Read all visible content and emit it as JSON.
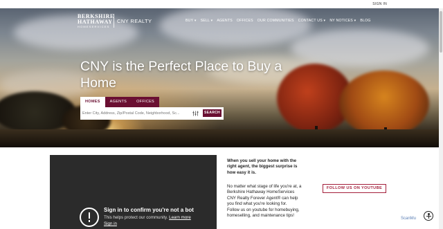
{
  "topbar": {
    "signin": "SIGN IN"
  },
  "brand": {
    "line1": "BERKSHIRE",
    "line2": "HATHAWAY",
    "line3": "HOMESERVICES",
    "office": "CNY REALTY"
  },
  "nav": {
    "items": [
      {
        "label": "BUY ▾"
      },
      {
        "label": "SELL ▾"
      },
      {
        "label": "AGENTS"
      },
      {
        "label": "OFFICES"
      },
      {
        "label": "OUR COMMUNITIES"
      },
      {
        "label": "CONTACT US ▾"
      },
      {
        "label": "NY NOTICES ▾"
      },
      {
        "label": "BLOG"
      }
    ]
  },
  "hero": {
    "headline": "CNY is the Perfect Place to Buy a Home"
  },
  "search": {
    "tabs": [
      {
        "label": "HOMES"
      },
      {
        "label": "AGENTS"
      },
      {
        "label": "OFFICES"
      }
    ],
    "placeholder": "Enter City, Address, Zip/Postal Code, Neighborhood, Sc...",
    "button": "SEARCH"
  },
  "video": {
    "title": "Sign in to confirm you're not a bot",
    "subtitle": "This helps protect our community.",
    "learn_more": "Learn more",
    "signin": "Sign in"
  },
  "content": {
    "lead": "When you sell your home with the right agent, the biggest surprise is how easy it is.",
    "body1": "No matter what stage of life you're at, a Berkshire Hathaway HomeServices CNY Realty Forever Agent® can help you find what you're looking for.",
    "body2": "Follow us on youtube for homebuying, homeselling, and maintenance tips!",
    "youtube_button": "FOLLOW US ON YOUTUBE"
  },
  "widgets": {
    "scan_label": "ScanMu"
  }
}
